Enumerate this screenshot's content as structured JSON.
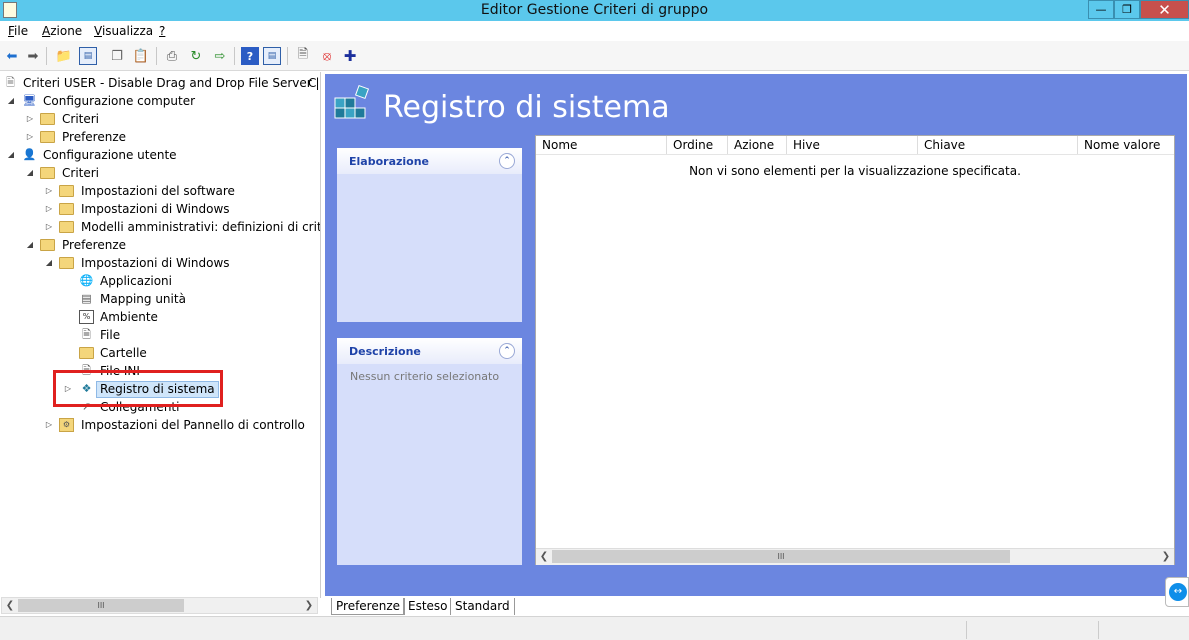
{
  "window": {
    "title": "Editor Gestione Criteri di gruppo",
    "minimize": "—",
    "maximize": "❐",
    "close": "✕"
  },
  "menu": {
    "items": [
      {
        "label": "File",
        "accel": "F"
      },
      {
        "label": "Azione",
        "accel": "A"
      },
      {
        "label": "Visualizza",
        "accel": "V"
      },
      {
        "label": "?",
        "accel": "?"
      }
    ]
  },
  "toolbar": {
    "icons": [
      "back-arrow-icon",
      "forward-arrow-icon",
      "up-folder-icon",
      "show-hide-tree-icon",
      "copy-icon",
      "paste-icon",
      "print-icon",
      "refresh-icon",
      "export-list-icon",
      "help-icon",
      "properties-icon",
      "show-details-icon",
      "stop-icon",
      "add-icon"
    ]
  },
  "tree": {
    "root": "Criteri USER - Disable Drag and Drop File Server |",
    "root_suffix": "C",
    "nodes": {
      "configurazione_computer": "Configurazione computer",
      "criteri_1": "Criteri",
      "preferenze_1": "Preferenze",
      "configurazione_utente": "Configurazione utente",
      "criteri_2": "Criteri",
      "impostazioni_software": "Impostazioni del software",
      "impostazioni_windows_1": "Impostazioni di Windows",
      "modelli_amministrativi": "Modelli amministrativi: definizioni di criteri (f",
      "preferenze_2": "Preferenze",
      "impostazioni_windows_2": "Impostazioni di Windows",
      "applicazioni": "Applicazioni",
      "mapping_unita": "Mapping unità",
      "ambiente": "Ambiente",
      "file": "File",
      "cartelle": "Cartelle",
      "file_ini": "File INI",
      "registro_sistema": "Registro di sistema",
      "collegamenti": "Collegamenti",
      "impostazioni_pannello": "Impostazioni del Pannello di controllo"
    }
  },
  "main": {
    "title": "Registro di sistema",
    "panels": {
      "elaborazione": {
        "title": "Elaborazione"
      },
      "descrizione": {
        "title": "Descrizione",
        "text": "Nessun criterio selezionato"
      }
    },
    "columns": [
      "Nome",
      "Ordine",
      "Azione",
      "Hive",
      "Chiave",
      "Nome valore"
    ],
    "empty_message": "Non vi sono elementi per la visualizzazione specificata.",
    "scrollbar_grip": "III"
  },
  "tabs": [
    "Preferenze",
    "Esteso",
    "Standard"
  ],
  "colors": {
    "titlebar": "#5bc8ec",
    "close_button": "#c7504c",
    "content_blue": "#6b86e0",
    "panel_bg": "#d6defa",
    "highlight_box": "#e0201f"
  }
}
